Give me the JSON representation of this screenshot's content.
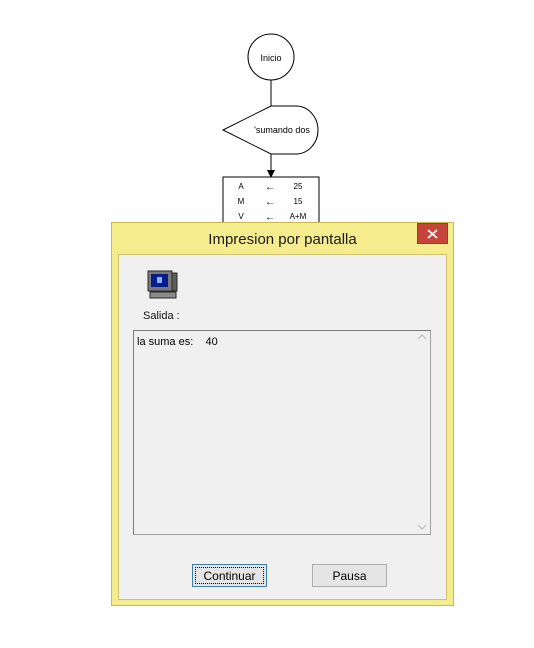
{
  "flowchart": {
    "start_label": "Inicio",
    "display_label": "'sumando dos",
    "assignments": [
      {
        "var": "A",
        "arrow": "←",
        "value": "25"
      },
      {
        "var": "M",
        "arrow": "←",
        "value": "15"
      },
      {
        "var": "V",
        "arrow": "←",
        "value": "A+M"
      }
    ]
  },
  "dialog": {
    "title": "Impresion por pantalla",
    "close_symbol": "✕",
    "salida_label": "Salida :",
    "output_text": "la suma es:    40",
    "continue_label": "Continuar",
    "pause_label": "Pausa",
    "icon": "computer-monitor-icon"
  },
  "colors": {
    "title_bar": "#f5ec8d",
    "close_button": "#c6453b",
    "client_bg": "#f0f0f0"
  }
}
